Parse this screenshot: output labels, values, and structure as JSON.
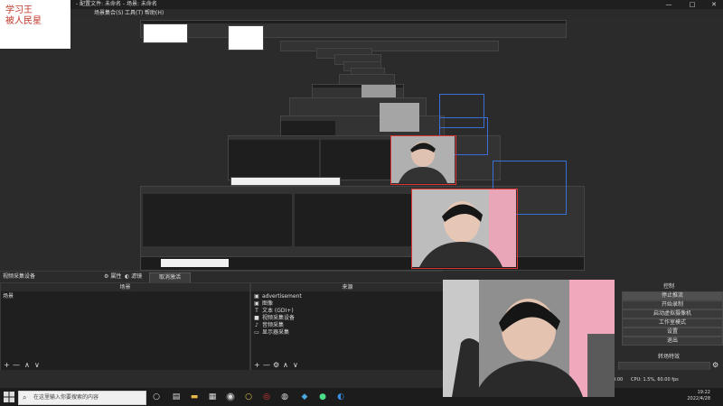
{
  "window": {
    "title": "配置文件: 未命名 - 场景: 未命名",
    "title_prefix": "- 配置文件: 未命名 - 场景: 未命名",
    "controls": [
      "—",
      "□",
      "✕"
    ]
  },
  "menu": [
    "场景集合(S)",
    "工具(T)",
    "帮助(H)"
  ],
  "logo": {
    "line1": "学习王",
    "line2": "被人民星"
  },
  "toolstrip": {
    "source_label": "视频采集设备",
    "properties": "属性",
    "filters": "滤镜",
    "deactivate": "取消激活"
  },
  "scenes": {
    "header": "场景",
    "items": [
      "场景"
    ]
  },
  "sources": {
    "header": "来源",
    "items": [
      {
        "icon": "image-icon",
        "label": "advertisement"
      },
      {
        "icon": "image-icon",
        "label": "图像"
      },
      {
        "icon": "text-icon",
        "label": "文本 (GDI+)"
      },
      {
        "icon": "camera-icon",
        "label": "视频采集设备"
      },
      {
        "icon": "audio-icon",
        "label": "音频采集"
      },
      {
        "icon": "monitor-icon",
        "label": "显示器采集"
      }
    ]
  },
  "controls": {
    "header": "控制",
    "buttons": [
      "停止推流",
      "开始录制",
      "启动虚拟摄像机",
      "工作室模式",
      "设置",
      "退出"
    ],
    "transition_header": "转场特效"
  },
  "status": {
    "cpu": "CPU: 1.5%, 60.00 fps",
    "fragment": "0:00"
  },
  "taskbar": {
    "search_placeholder": "在这里输入你要搜索的内容",
    "time": "19:22",
    "date": "2022/4/28"
  },
  "colors": {
    "selection": "#dd3333",
    "guide": "#3a6fd8",
    "panel": "#1f1f1f",
    "background": "#2b2b2b"
  }
}
